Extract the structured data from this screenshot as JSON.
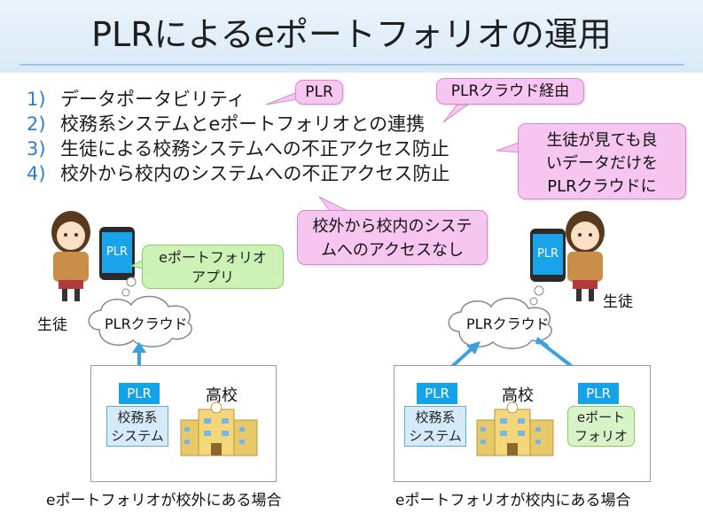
{
  "title": "PLRによるeポートフォリオの運用",
  "list": [
    {
      "num": "1)",
      "text": "データポータビリティ"
    },
    {
      "num": "2)",
      "text": "校務系システムとeポートフォリオとの連携"
    },
    {
      "num": "3)",
      "text": "生徒による校務システムへの不正アクセス防止"
    },
    {
      "num": "4)",
      "text": "校外から校内のシステムへの不正アクセス防止"
    }
  ],
  "callouts": {
    "plr": "PLR",
    "plr_cloud_via": "PLRクラウド経由",
    "student_data": [
      "生徒が見ても良",
      "いデータだけを",
      "PLRクラウドに"
    ],
    "no_access": [
      "校外から校内のシステ",
      "ムへのアクセスなし"
    ]
  },
  "left": {
    "phone_label": "PLR",
    "app_bubble": [
      "eポートフォリオ",
      "アプリ"
    ],
    "student": "生徒",
    "cloud": "PLRクラウド",
    "plr_box": "PLR",
    "school": "高校",
    "system_box": [
      "校務系",
      "システム"
    ],
    "caption": "eポートフォリオが校外にある場合"
  },
  "right": {
    "phone_label": "PLR",
    "student": "生徒",
    "cloud": "PLRクラウド",
    "plr_box_1": "PLR",
    "plr_box_2": "PLR",
    "school": "高校",
    "system_box": [
      "校務系",
      "システム"
    ],
    "eportfolio_box": [
      "eポート",
      "フォリオ"
    ],
    "caption": "eポートフォリオが校内にある場合"
  },
  "colors": {
    "accent": "#14a3e6",
    "callout": "#f7c6f0",
    "green": "#cdf2b6",
    "arrow": "#3aa0e0"
  }
}
